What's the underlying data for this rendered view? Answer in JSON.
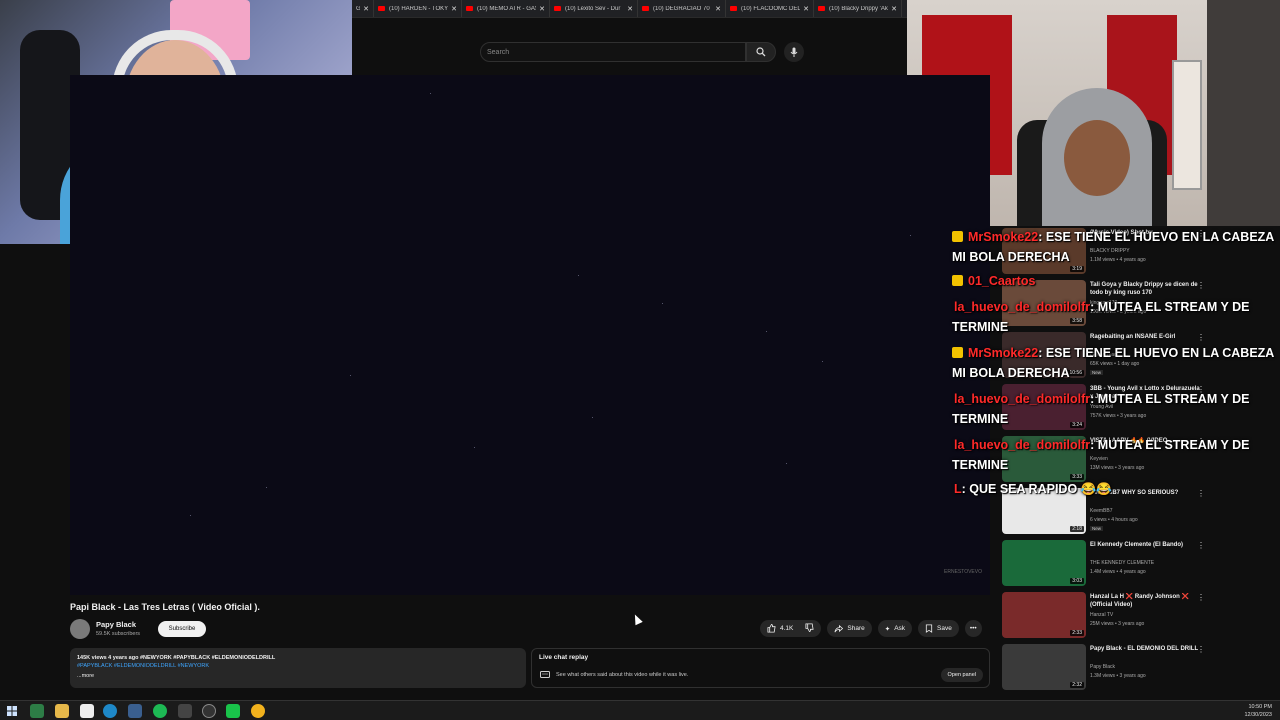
{
  "browser": {
    "tabs": [
      {
        "label": "Gan"
      },
      {
        "label": "(10) HARDEN - TOKYO"
      },
      {
        "label": "(10) MEMO ATR - GAS"
      },
      {
        "label": "(10) Lexito Sev - Dur"
      },
      {
        "label": "(10) DEGRACIAO 70"
      },
      {
        "label": "(10) FLACOOMC DEL"
      },
      {
        "label": "(10) Blacky Drippy 'Ak"
      }
    ]
  },
  "youtube_header": {
    "search_placeholder": "Search"
  },
  "player": {
    "watermark": "ERNESTOVEVO"
  },
  "video": {
    "title": "Papi Black - Las Tres Letras ( Video Oficial ).",
    "channel": "Papy Black",
    "subscribers": "59.5K subscribers",
    "subscribe_label": "Subscribe",
    "likes": "4.1K",
    "share_label": "Share",
    "ask_label": "Ask",
    "save_label": "Save",
    "description_meta": "145K views  4 years ago  #NEWYORK #PAPYBLACK #ELDEMONIODELDRILL",
    "description_tags": "#PAPYBLACK #ELDEMONIODELDRILL #NEWYORK",
    "more_label": "...more"
  },
  "live_chat": {
    "title": "Live chat replay",
    "subtitle": "See what others said about this video while it was live.",
    "open_panel_label": "Open panel"
  },
  "recommendations": [
    {
      "title": "(Music Video) Shot by...",
      "channel": "BLACKY DRIPPY",
      "views": "1.1M views • 4 years ago",
      "duration": "3:19",
      "badge": ""
    },
    {
      "title": "Tali Goya y Blacky Drippy se dicen de todo by king ruso 170",
      "channel": "kingruso170",
      "views": "100K views • 3 years ago",
      "duration": "3:58",
      "badge": ""
    },
    {
      "title": "Ragebaiting an INSANE E-Girl",
      "channel": "iShowBread",
      "views": "65K views • 1 day ago",
      "duration": "10:56",
      "badge": "New"
    },
    {
      "title": "3BB - Young Avil x Lotto x Delurazuela x Jaybeat",
      "channel": "Young Avil",
      "views": "757K views • 3 years ago",
      "duration": "3:24",
      "badge": ""
    },
    {
      "title": "VISTA | AAPV 🔥🔥 (VIDEO ...",
      "channel": "Keyvien",
      "views": "13M views • 3 years ago",
      "duration": "3:33",
      "badge": ""
    },
    {
      "title": "Keem BB7 WHY SO SERIOUS?",
      "channel": "KeemBB7",
      "views": "6 views • 4 hours ago",
      "duration": "2:18",
      "badge": "New"
    },
    {
      "title": "El Kennedy Clemente (El Bando)",
      "channel": "THE KENNEDY CLEMENTE",
      "views": "1.4M views • 4 years ago",
      "duration": "3:03",
      "badge": ""
    },
    {
      "title": "Hanzal La H ❌ Randy Johnson ❌ (Official Video)",
      "channel": "Hanzal TV",
      "views": "25M views • 3 years ago",
      "duration": "2:33",
      "badge": ""
    },
    {
      "title": "Papy Black - EL DEMONIO DEL DRILL",
      "channel": "Papy Black",
      "views": "1.3M views • 3 years ago",
      "duration": "2:32",
      "badge": ""
    }
  ],
  "chat": [
    {
      "user": "MrSmoke22",
      "text": ": ESE TIENE EL HUEVO EN LA CABEZA",
      "cont": "MI BOLA DERECHA",
      "crown": true
    },
    {
      "user": "01_Caartos",
      "text": "",
      "cont": "",
      "crown": true
    },
    {
      "user": "la_huevo_de_domilolfr",
      "text": ": MUTEA EL STREAM Y DE",
      "cont": "TERMINE",
      "crown": false
    },
    {
      "user": "MrSmoke22",
      "text": ": ESE TIENE EL HUEVO EN LA CABEZA",
      "cont": "MI BOLA DERECHA",
      "crown": true
    },
    {
      "user": "la_huevo_de_domilolfr",
      "text": ": MUTEA EL STREAM Y DE",
      "cont": "TERMINE",
      "crown": false
    },
    {
      "user": "la_huevo_de_domilolfr",
      "text": ": MUTEA EL STREAM Y DE",
      "cont": "TERMINE",
      "crown": false
    },
    {
      "user": "L",
      "text": ": QUE SEA RAPIDO 😂😂",
      "cont": "",
      "crown": false
    }
  ],
  "taskbar": {
    "time": "10:50 PM",
    "date": "12/30/2023"
  }
}
